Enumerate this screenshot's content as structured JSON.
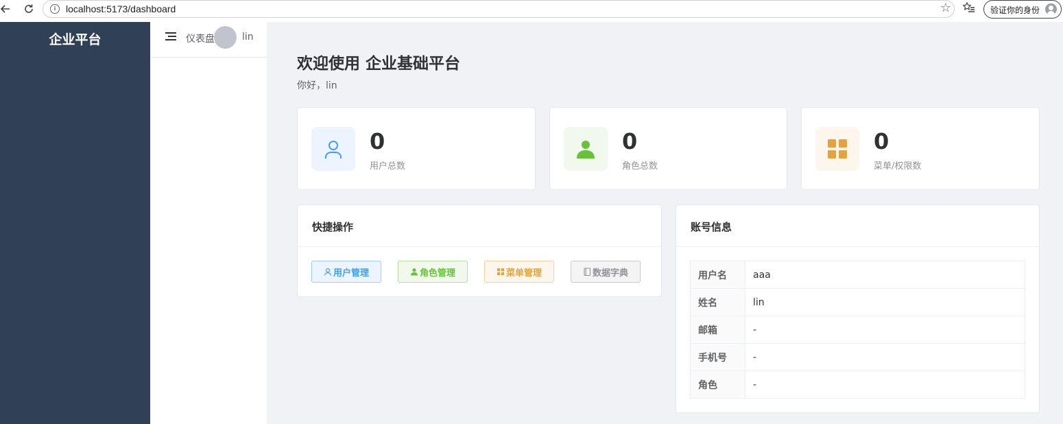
{
  "browser": {
    "url": "localhost:5173/dashboard",
    "verify_label": "验证你的身份"
  },
  "sidebar": {
    "brand": "企业平台"
  },
  "header": {
    "breadcrumb": "仪表盘",
    "username": "lin"
  },
  "welcome": {
    "title": "欢迎使用 企业基础平台",
    "greeting": "你好，lin"
  },
  "stats": [
    {
      "value": "0",
      "label": "用户总数",
      "icon": "user-icon",
      "color": "#409eff",
      "bg": "#ecf5ff"
    },
    {
      "value": "0",
      "label": "角色总数",
      "icon": "user-filled-icon",
      "color": "#67c23a",
      "bg": "#f0f9eb"
    },
    {
      "value": "0",
      "label": "菜单/权限数",
      "icon": "grid-icon",
      "color": "#e6a23c",
      "bg": "#fdf6ec"
    }
  ],
  "quick": {
    "title": "快捷操作",
    "buttons": [
      {
        "label": "用户管理",
        "icon": "user-icon",
        "color": "#409eff"
      },
      {
        "label": "角色管理",
        "icon": "user-filled-icon",
        "color": "#67c23a"
      },
      {
        "label": "菜单管理",
        "icon": "grid-icon",
        "color": "#e6a23c"
      },
      {
        "label": "数据字典",
        "icon": "notebook-icon",
        "color": "#909399"
      }
    ]
  },
  "account": {
    "title": "账号信息",
    "rows": [
      {
        "key": "用户名",
        "value": "aaa"
      },
      {
        "key": "姓名",
        "value": "lin"
      },
      {
        "key": "邮箱",
        "value": "-"
      },
      {
        "key": "手机号",
        "value": "-"
      },
      {
        "key": "角色",
        "value": "-"
      }
    ]
  }
}
